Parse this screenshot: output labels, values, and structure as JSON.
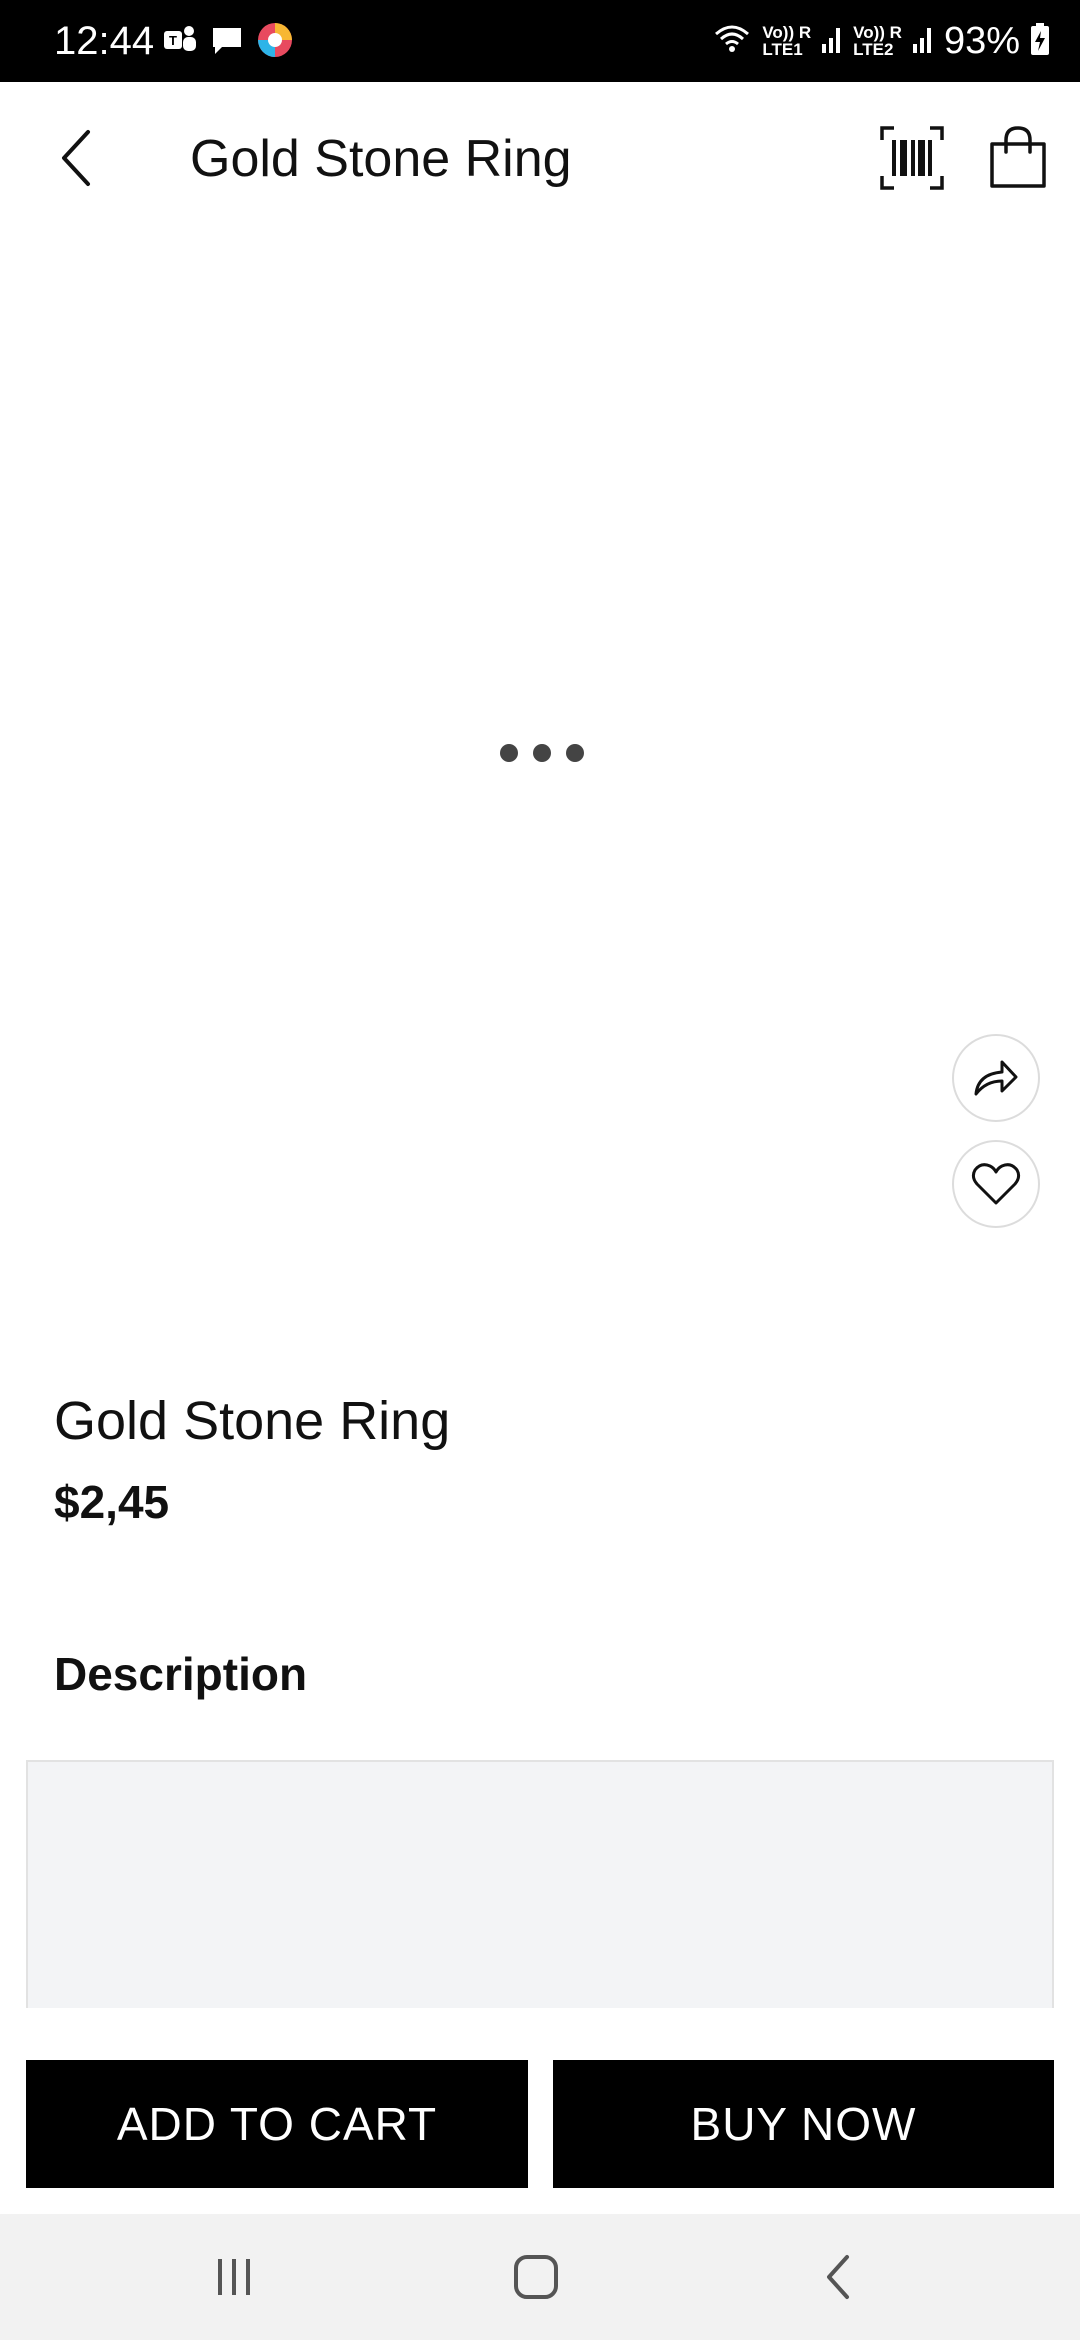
{
  "status_bar": {
    "time": "12:44",
    "left_icons": [
      "teams-icon",
      "message-icon",
      "browser-icon"
    ],
    "sim1": {
      "top": "Vo)) R",
      "bottom": "LTE1"
    },
    "sim2": {
      "top": "Vo)) R",
      "bottom": "LTE2"
    },
    "battery": "93%"
  },
  "app_bar": {
    "title": "Gold Stone Ring",
    "icons": [
      "back-arrow-icon",
      "barcode-icon",
      "shopping-bag-icon"
    ]
  },
  "product": {
    "name": "Gold Stone Ring",
    "price": "$2,45",
    "description_heading": "Description",
    "description_text": ""
  },
  "image_actions": [
    "share-icon",
    "heart-icon"
  ],
  "actions": {
    "add_to_cart": "ADD TO CART",
    "buy_now": "BUY NOW"
  },
  "nav_bar": {
    "icons": [
      "recents-icon",
      "home-icon",
      "back-icon"
    ]
  },
  "colors": {
    "status_bar_bg": "#000000",
    "button_bg": "#000000",
    "button_text": "#ffffff",
    "description_bg": "#f3f4f6",
    "nav_bg": "#f2f2f2"
  }
}
